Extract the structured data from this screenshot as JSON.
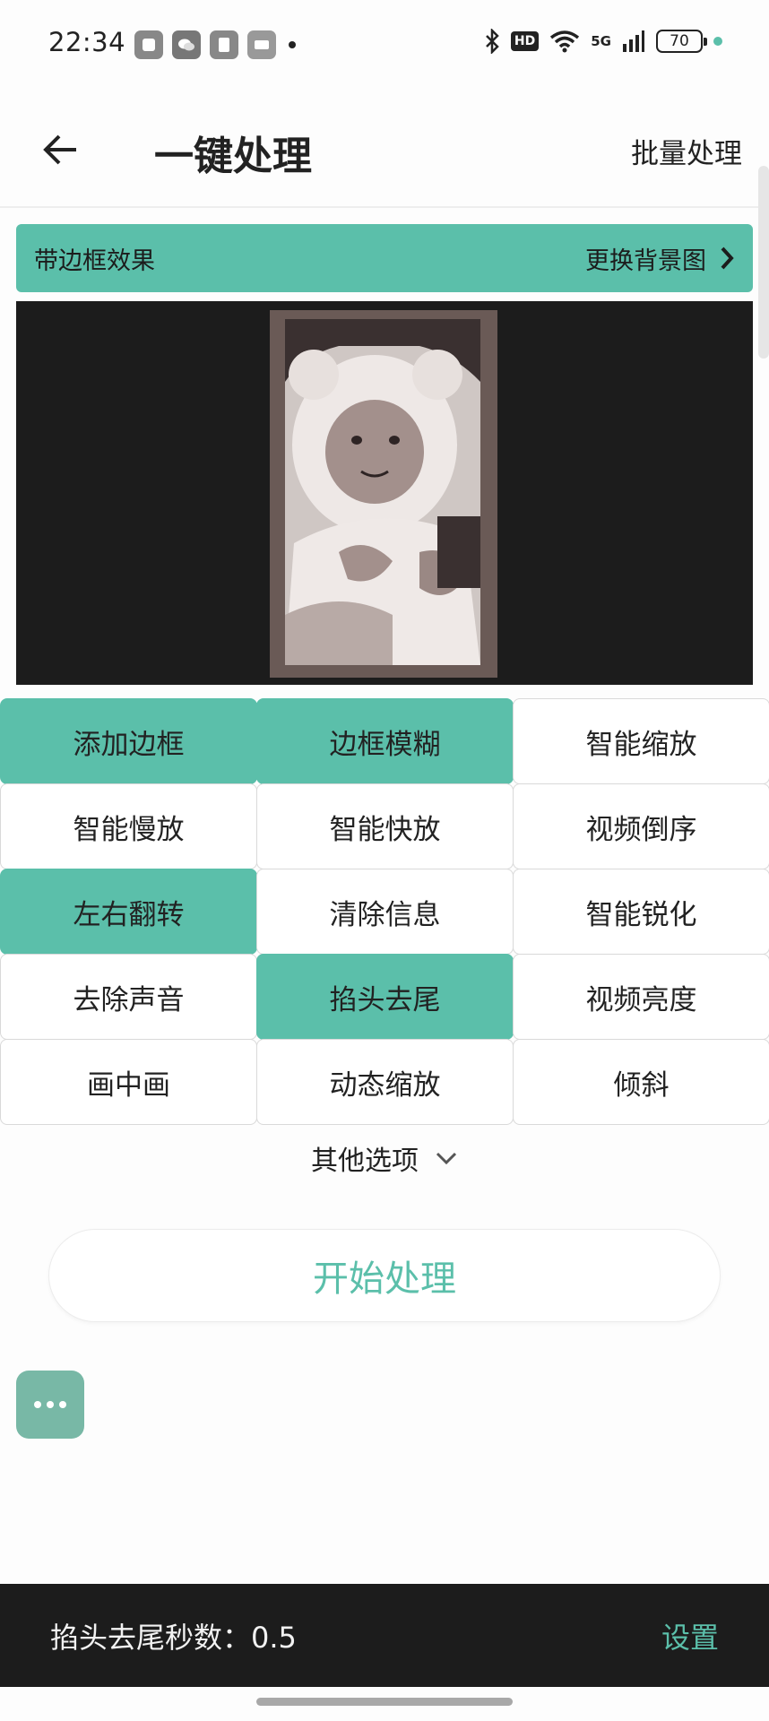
{
  "status_bar": {
    "time": "22:34",
    "notification_icons": [
      "app-icon",
      "wechat-icon",
      "app-icon",
      "app-icon"
    ],
    "network": "5G",
    "hd_label": "HD",
    "battery": "70"
  },
  "header": {
    "title": "一键处理",
    "batch_label": "批量处理"
  },
  "banner": {
    "label": "带边框效果",
    "change_bg_label": "更换背景图"
  },
  "options": [
    {
      "label": "添加边框",
      "active": true
    },
    {
      "label": "边框模糊",
      "active": true
    },
    {
      "label": "智能缩放",
      "active": false
    },
    {
      "label": "智能慢放",
      "active": false
    },
    {
      "label": "智能快放",
      "active": false
    },
    {
      "label": "视频倒序",
      "active": false
    },
    {
      "label": "左右翻转",
      "active": true
    },
    {
      "label": "清除信息",
      "active": false
    },
    {
      "label": "智能锐化",
      "active": false
    },
    {
      "label": "去除声音",
      "active": false
    },
    {
      "label": "掐头去尾",
      "active": true
    },
    {
      "label": "视频亮度",
      "active": false
    },
    {
      "label": "画中画",
      "active": false
    },
    {
      "label": "动态缩放",
      "active": false
    },
    {
      "label": "倾斜",
      "active": false
    }
  ],
  "more_options_label": "其他选项",
  "start_button_label": "开始处理",
  "bottom_bar": {
    "info_text": "掐头去尾秒数：0.5",
    "settings_label": "设置"
  },
  "colors": {
    "accent": "#5bbfaa",
    "dark": "#1c1c1c"
  }
}
